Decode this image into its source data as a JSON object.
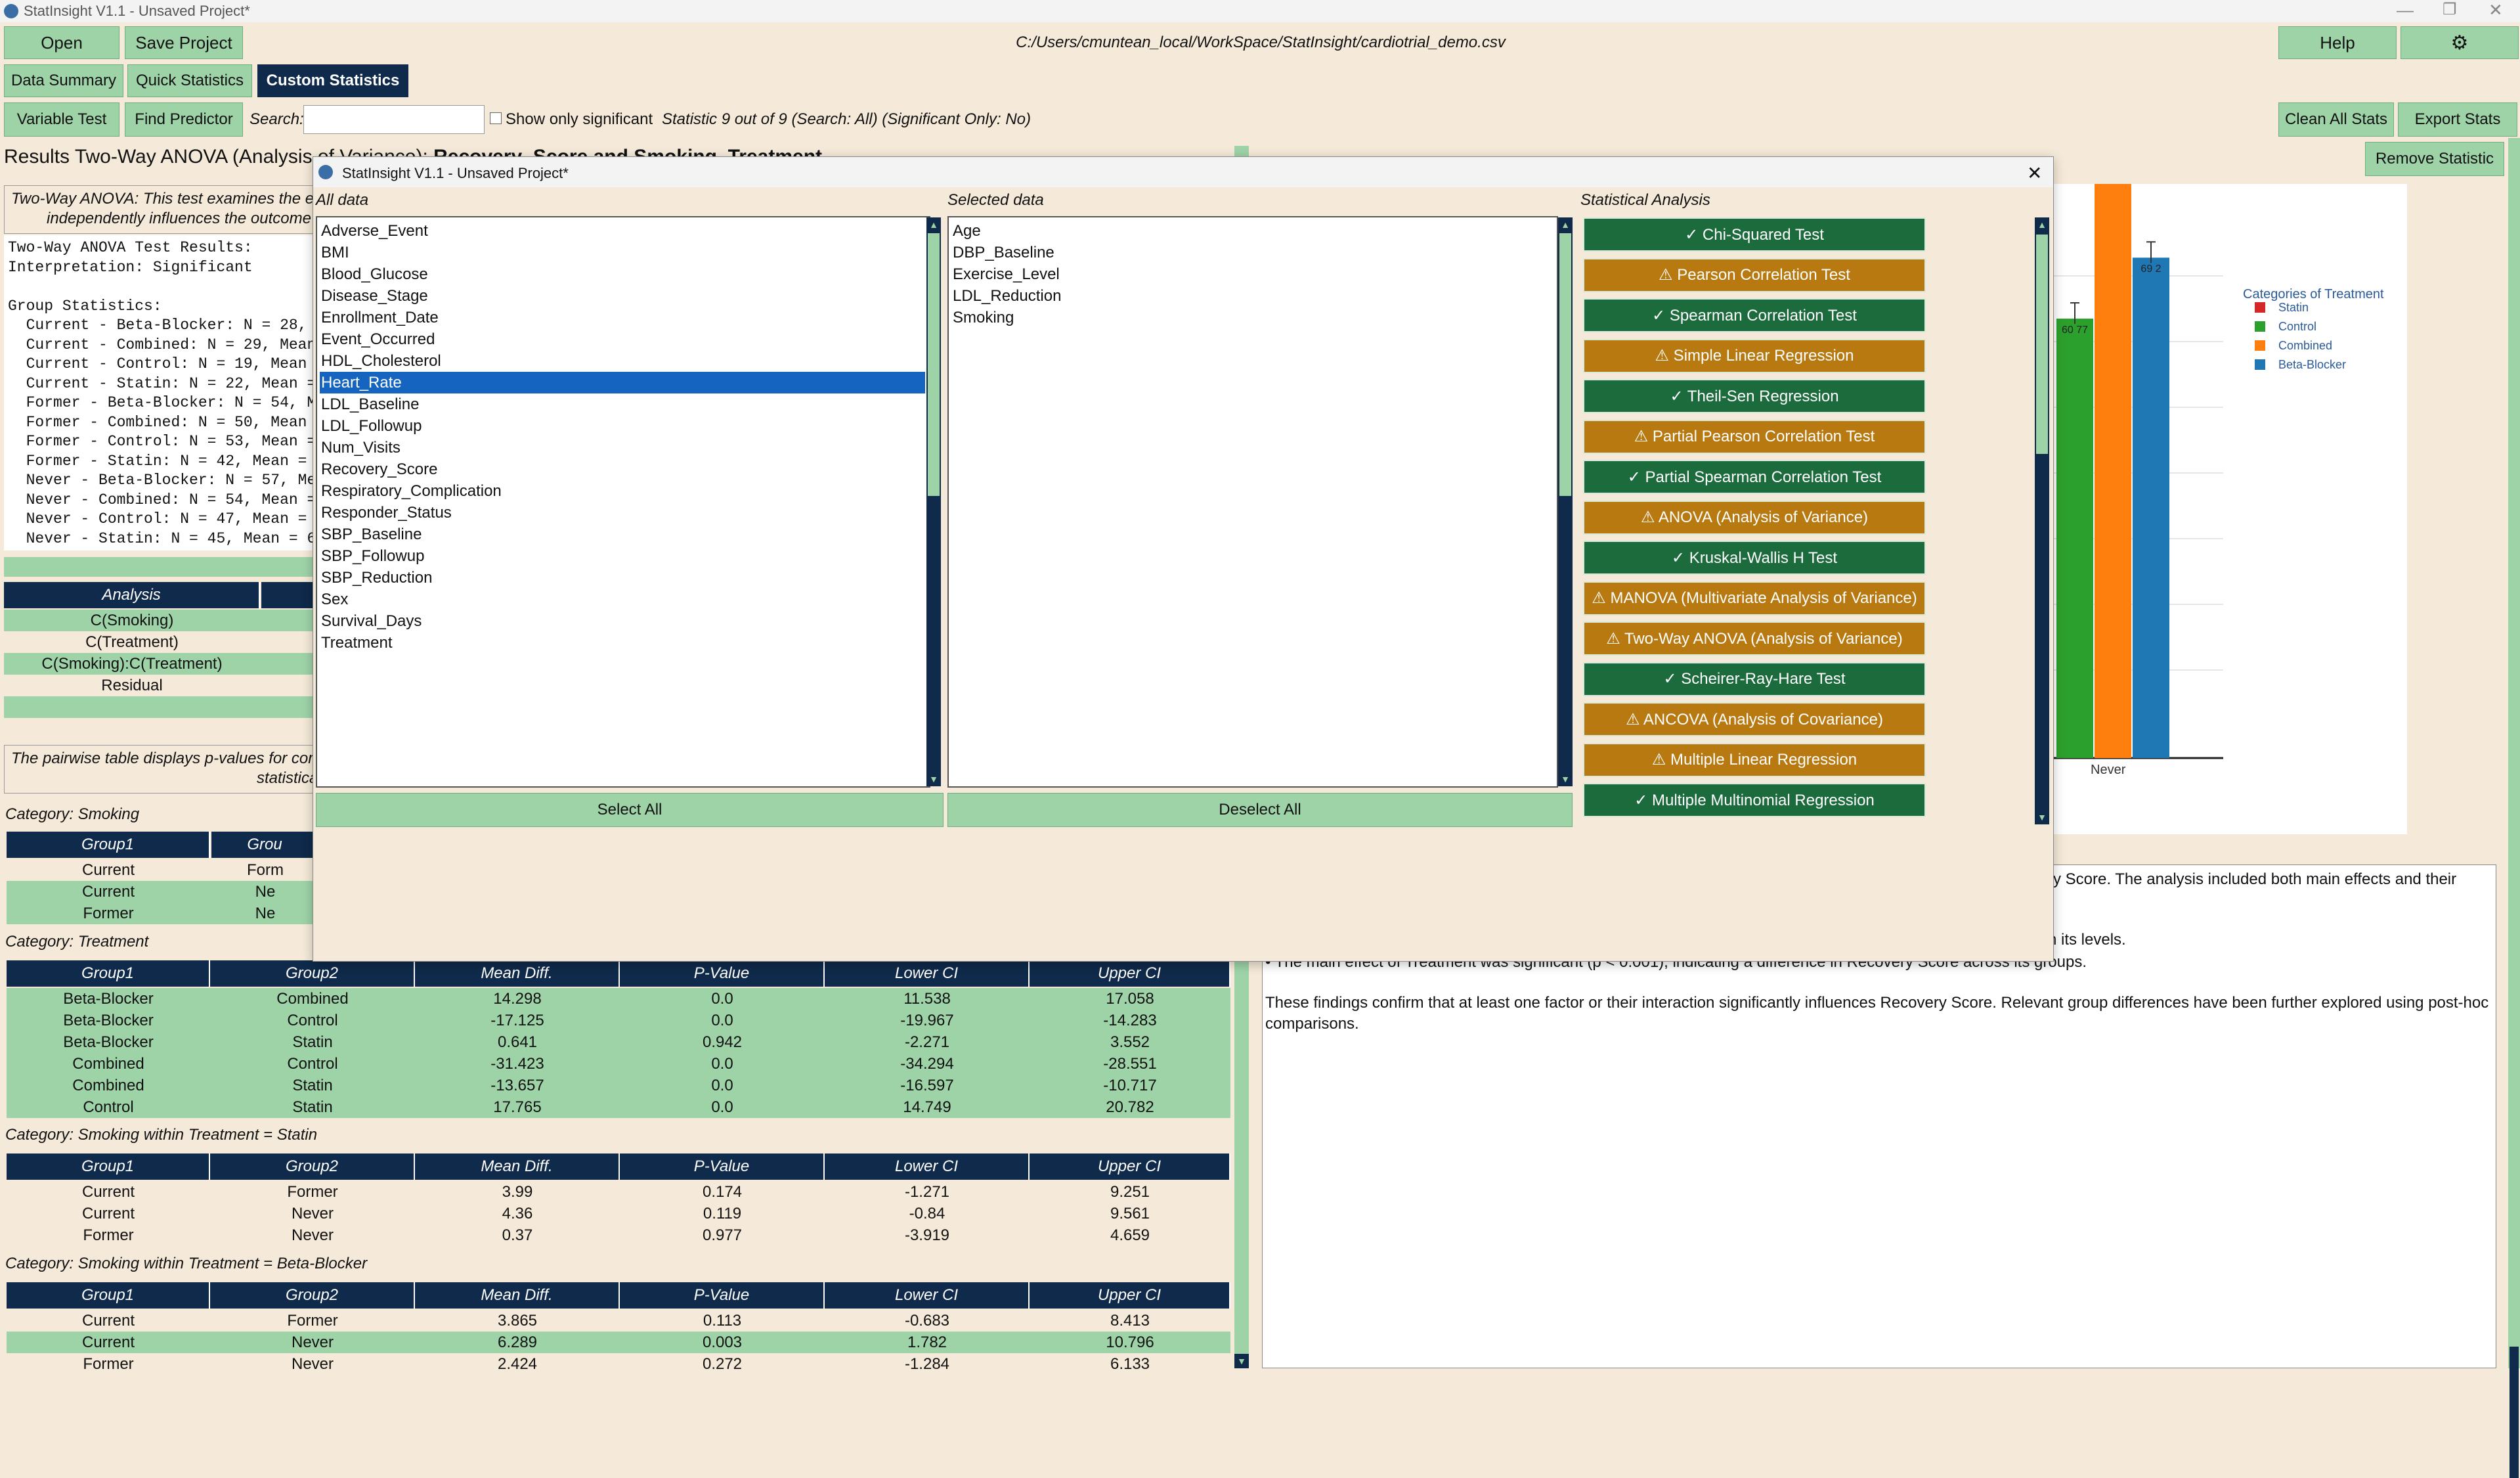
{
  "window": {
    "title": "StatInsight V1.1 - Unsaved Project*"
  },
  "toolbar": {
    "open": "Open",
    "save": "Save Project",
    "path": "C:/Users/cmuntean_local/WorkSpace/StatInsight/cardiotrial_demo.csv",
    "help": "Help",
    "settings_icon": "gear-icon"
  },
  "tabs": {
    "data_summary": "Data Summary",
    "quick_statistics": "Quick Statistics",
    "custom_statistics": "Custom Statistics"
  },
  "subtoolbar": {
    "variable_test": "Variable Test",
    "find_predictor": "Find Predictor",
    "search_label": "Search:",
    "search_value": "",
    "show_only_significant": "Show only significant",
    "status": "Statistic 9 out of 9 (Search: All) (Significant Only: No)",
    "clean_all": "Clean All Stats",
    "export": "Export Stats"
  },
  "results": {
    "title_prefix": "Results Two-Way ANOVA (Analysis o",
    "title_tail": "f Variance): ",
    "title_bold": "Recovery_Score and Smoking, Treatment",
    "remove": "Remove Statistic",
    "desc_line1": "Two-Way ANOVA: This test examines the eff",
    "desc_line2": "independently influences the outcome c",
    "output_lines": [
      "Two-Way ANOVA Test Results:",
      "Interpretation: Significant",
      "",
      "Group Statistics:",
      "  Current - Beta-Blocker: N = 28, M",
      "  Current - Combined: N = 29, Mean",
      "  Current - Control: N = 19, Mean =",
      "  Current - Statin: N = 22, Mean =",
      "  Former - Beta-Blocker: N = 54, Me",
      "  Former - Combined: N = 50, Mean =",
      "  Former - Control: N = 53, Mean =",
      "  Former - Statin: N = 42, Mean = 6",
      "  Never - Beta-Blocker: N = 57, Mea",
      "  Never - Combined: N = 54, Mean =",
      "  Never - Control: N = 47, Mean = 5",
      "  Never - Statin: N = 45, Mean = 67"
    ],
    "anova_header": "Analysis",
    "anova_rows": [
      "C(Smoking)",
      "C(Treatment)",
      "C(Smoking):C(Treatment)",
      "Residual"
    ],
    "pairwise_line1": "The pairwise table displays p-values for com",
    "pairwise_line2": "statistica",
    "cat_smoking": "Category: Smoking",
    "cat_smoking_headers": [
      "Group1",
      "Grou"
    ],
    "cat_smoking_rows": [
      [
        "Current",
        "Form"
      ],
      [
        "Current",
        "Ne"
      ],
      [
        "Former",
        "Ne"
      ]
    ],
    "cat_treatment": "Category: Treatment",
    "headers": [
      "Group1",
      "Group2",
      "Mean Diff.",
      "P-Value",
      "Lower CI",
      "Upper CI"
    ],
    "treatment_rows": [
      [
        "Beta-Blocker",
        "Combined",
        "14.298",
        "0.0",
        "11.538",
        "17.058"
      ],
      [
        "Beta-Blocker",
        "Control",
        "-17.125",
        "0.0",
        "-19.967",
        "-14.283"
      ],
      [
        "Beta-Blocker",
        "Statin",
        "0.641",
        "0.942",
        "-2.271",
        "3.552"
      ],
      [
        "Combined",
        "Control",
        "-31.423",
        "0.0",
        "-34.294",
        "-28.551"
      ],
      [
        "Combined",
        "Statin",
        "-13.657",
        "0.0",
        "-16.597",
        "-10.717"
      ],
      [
        "Control",
        "Statin",
        "17.765",
        "0.0",
        "14.749",
        "20.782"
      ]
    ],
    "cat_statin": "Category: Smoking within Treatment = Statin",
    "statin_rows": [
      [
        "Current",
        "Former",
        "3.99",
        "0.174",
        "-1.271",
        "9.251"
      ],
      [
        "Current",
        "Never",
        "4.36",
        "0.119",
        "-0.84",
        "9.561"
      ],
      [
        "Former",
        "Never",
        "0.37",
        "0.977",
        "-3.919",
        "4.659"
      ]
    ],
    "cat_beta": "Category: Smoking within Treatment = Beta-Blocker",
    "beta_rows": [
      [
        "Current",
        "Former",
        "3.865",
        "0.113",
        "-0.683",
        "8.413"
      ],
      [
        "Current",
        "Never",
        "6.289",
        "0.003",
        "1.782",
        "10.796"
      ],
      [
        "Former",
        "Never",
        "2.424",
        "0.272",
        "-1.284",
        "6.133"
      ]
    ]
  },
  "summary": {
    "line1": "ry Score. The analysis included both main effects and their",
    "line2": "n its levels.",
    "line3": "• The main effect of Treatment was significant (p < 0.001), indicating a difference in Recovery Score across its groups.",
    "line4": "These findings confirm that at least one factor or their interaction significantly influences Recovery Score. Relevant group differences have been further explored using post-hoc",
    "line5": "comparisons."
  },
  "chart_data": {
    "type": "bar",
    "legend_title": "Categories of  Treatment",
    "legend_position": "top-right",
    "categories": [
      "Never"
    ],
    "series": [
      {
        "name": "Statin",
        "color": "#d62728",
        "values": [
          null
        ]
      },
      {
        "name": "Control",
        "color": "#2ca02c",
        "values": [
          60.77
        ]
      },
      {
        "name": "Combined",
        "color": "#ff7f0e",
        "values": [
          83.32
        ]
      },
      {
        "name": "Beta-Blocker",
        "color": "#1f77b4",
        "values": [
          69.2
        ]
      }
    ],
    "data_labels": [
      "60 77",
      "83.32",
      "69 2"
    ]
  },
  "dialog": {
    "title": "StatInsight V1.1 - Unsaved Project*",
    "close": "✕",
    "all_data_label": "All data",
    "selected_label": "Selected data",
    "analysis_label": "Statistical Analysis",
    "all_data": [
      "Adverse_Event",
      "BMI",
      "Blood_Glucose",
      "Disease_Stage",
      "Enrollment_Date",
      "Event_Occurred",
      "HDL_Cholesterol",
      "Heart_Rate",
      "LDL_Baseline",
      "LDL_Followup",
      "Num_Visits",
      "Recovery_Score",
      "Respiratory_Complication",
      "Responder_Status",
      "SBP_Baseline",
      "SBP_Followup",
      "SBP_Reduction",
      "Sex",
      "Survival_Days",
      "Treatment"
    ],
    "selected_index": 7,
    "selected_data": [
      "Age",
      "DBP_Baseline",
      "Exercise_Level",
      "LDL_Reduction",
      "Smoking"
    ],
    "select_all": "Select All",
    "deselect_all": "Deselect All",
    "analyses": [
      {
        "label": "✓ Chi-Squared Test",
        "status": "ok"
      },
      {
        "label": "⚠ Pearson Correlation Test",
        "status": "warn"
      },
      {
        "label": "✓ Spearman Correlation Test",
        "status": "ok"
      },
      {
        "label": "⚠ Simple Linear Regression",
        "status": "warn"
      },
      {
        "label": "✓ Theil-Sen Regression",
        "status": "ok"
      },
      {
        "label": "⚠ Partial Pearson Correlation Test",
        "status": "warn"
      },
      {
        "label": "✓ Partial Spearman Correlation Test",
        "status": "ok"
      },
      {
        "label": "⚠ ANOVA (Analysis of Variance)",
        "status": "warn"
      },
      {
        "label": "✓ Kruskal-Wallis H Test",
        "status": "ok"
      },
      {
        "label": "⚠ MANOVA (Multivariate Analysis of Variance)",
        "status": "warn"
      },
      {
        "label": "⚠ Two-Way ANOVA (Analysis of Variance)",
        "status": "warn"
      },
      {
        "label": "✓ Scheirer-Ray-Hare Test",
        "status": "ok"
      },
      {
        "label": "⚠ ANCOVA (Analysis of Covariance)",
        "status": "warn"
      },
      {
        "label": "⚠ Multiple Linear Regression",
        "status": "warn"
      },
      {
        "label": "✓ Multiple Multinomial Regression",
        "status": "ok"
      }
    ]
  }
}
